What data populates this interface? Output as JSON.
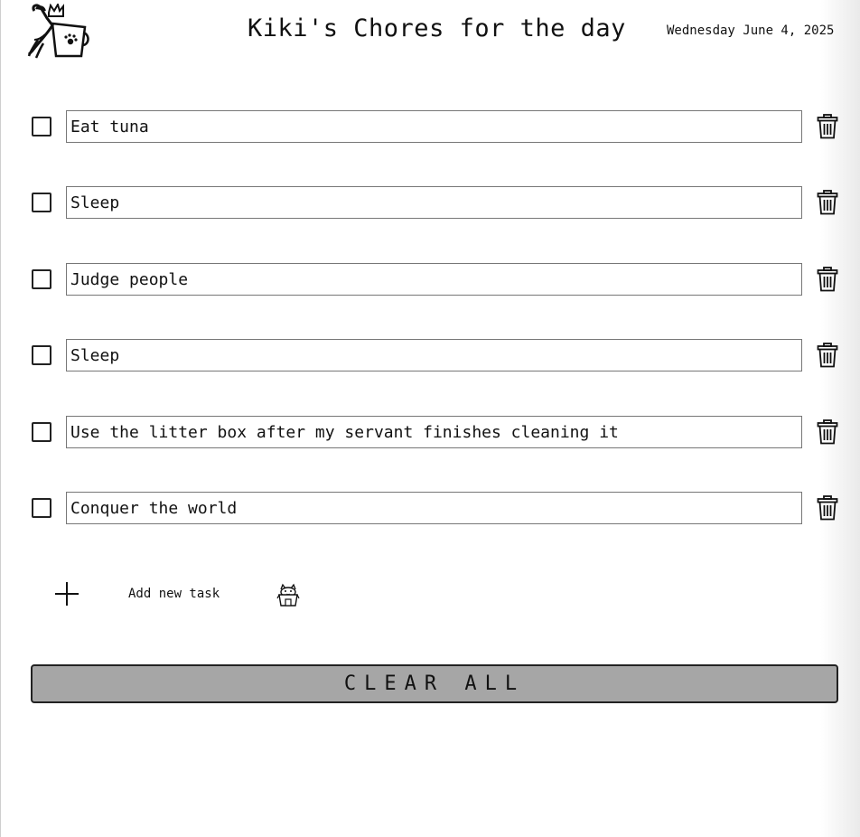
{
  "header": {
    "logo_icon": "cat-in-cup-logo-icon",
    "title": "Kiki's Chores for the day",
    "date": "Wednesday June 4, 2025"
  },
  "tasks": [
    {
      "text": "Eat tuna",
      "checked": false
    },
    {
      "text": "Sleep",
      "checked": false
    },
    {
      "text": "Judge people",
      "checked": false
    },
    {
      "text": "Sleep",
      "checked": false
    },
    {
      "text": "Use the litter box after my servant finishes cleaning it",
      "checked": false
    },
    {
      "text": "Conquer the world",
      "checked": false
    }
  ],
  "add_task": {
    "icon": "plus-icon",
    "label": "Add new task",
    "decor_icon": "cat-box-icon"
  },
  "clear_all": {
    "label": "CLEAR ALL"
  },
  "colors": {
    "clear_button_bg": "#a6a6a6",
    "border": "#777777",
    "text": "#111111"
  }
}
